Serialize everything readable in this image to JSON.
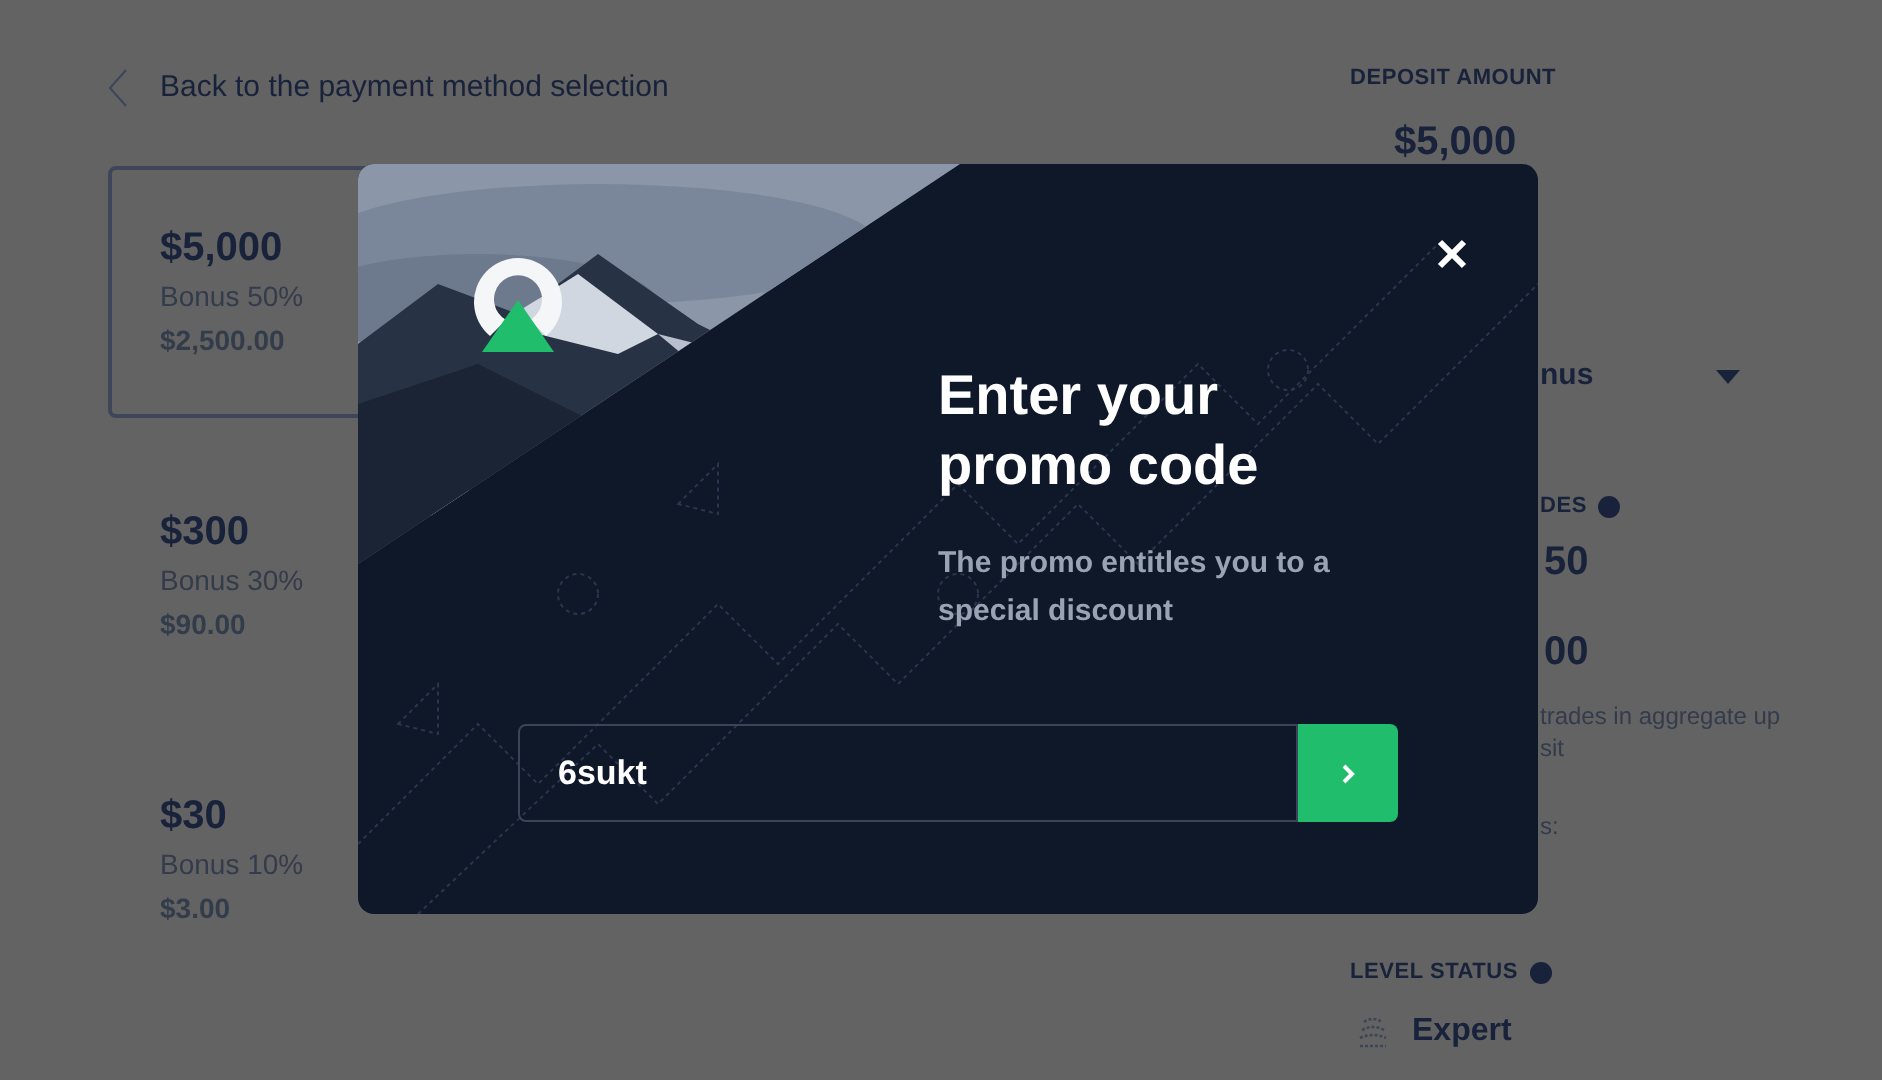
{
  "back_link": {
    "label": "Back to the payment method selection"
  },
  "amount_options": [
    {
      "amount": "$5,000",
      "bonus": "Bonus 50%",
      "bonus_amount": "$2,500.00",
      "selected": true
    },
    {
      "amount": "$300",
      "bonus": "Bonus 30%",
      "bonus_amount": "$90.00",
      "selected": false
    },
    {
      "amount": "$30",
      "bonus": "Bonus 10%",
      "bonus_amount": "$3.00",
      "selected": false
    }
  ],
  "sidebar": {
    "deposit_heading": "DEPOSIT AMOUNT",
    "deposit_value": "$5,000",
    "bonus_select": "nus",
    "trades_heading": "DES",
    "values": [
      "50",
      "00"
    ],
    "note_lines": [
      "trades in aggregate up",
      "sit"
    ],
    "label_fragment": "s:",
    "level_heading": "LEVEL STATUS",
    "level": "Expert"
  },
  "modal": {
    "title": "Enter your promo code",
    "subtitle": "The promo entitles you to a special discount",
    "input": {
      "value": "6sukt"
    }
  }
}
